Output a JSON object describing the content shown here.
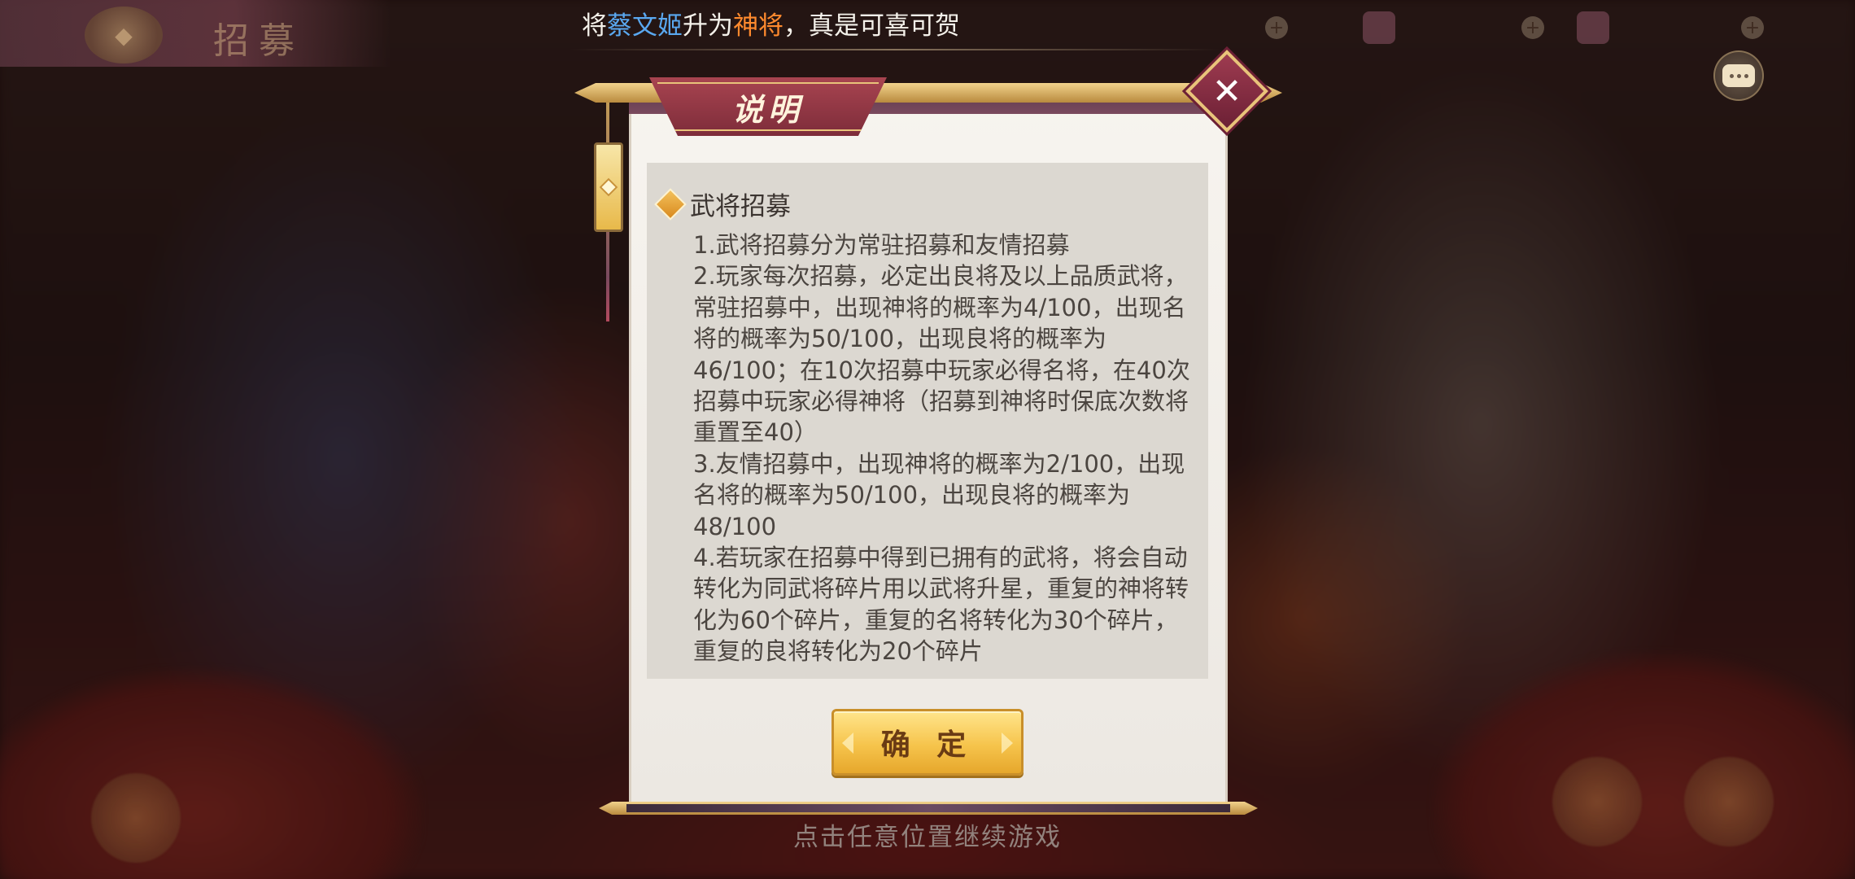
{
  "top_bar": {
    "tab_title": "招募",
    "ticker_prefix": "将",
    "ticker_hero_name": "蔡文姬",
    "ticker_middle": "升为",
    "ticker_rank": "神将",
    "ticker_suffix": "，真是可喜可贺",
    "colors": {
      "hero_name": "#5aa8f0",
      "rank": "#ff8a2e"
    }
  },
  "dialog": {
    "title": "说明",
    "section_title": "武将招募",
    "rules": [
      "1.武将招募分为常驻招募和友情招募",
      "2.玩家每次招募，必定出良将及以上品质武将，常驻招募中，出现神将的概率为4/100，出现名将的概率为50/100，出现良将的概率为46/100；在10次招募中玩家必得名将，在40次招募中玩家必得神将（招募到神将时保底次数将重置至40）",
      "3.友情招募中，出现神将的概率为2/100，出现名将的概率为50/100，出现良将的概率为48/100",
      "4.若玩家在招募中得到已拥有的武将，将会自动转化为同武将碎片用以武将升星，重复的神将转化为60个碎片，重复的名将转化为30个碎片，重复的良将转化为20个碎片"
    ],
    "confirm_label": "确 定"
  },
  "continue_hint": "点击任意位置继续游戏",
  "icons": {
    "close": "close-icon",
    "chat": "chat-icon",
    "section": "diamond-icon"
  }
}
